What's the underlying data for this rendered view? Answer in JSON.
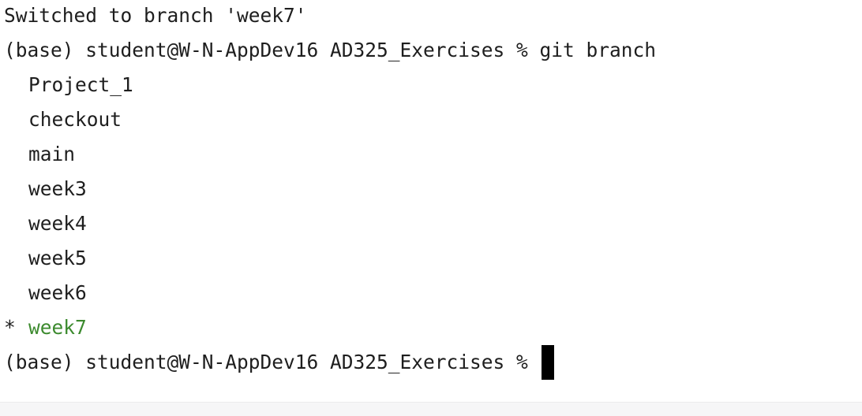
{
  "terminal": {
    "output_switch": "Switched to branch 'week7'",
    "prompt_1": "(base) student@W-N-AppDev16 AD325_Exercises % ",
    "command_1": "git branch",
    "branches": [
      "Project_1",
      "checkout",
      "main",
      "week3",
      "week4",
      "week5",
      "week6"
    ],
    "current_marker": "*",
    "current_branch": "week7",
    "prompt_2": "(base) student@W-N-AppDev16 AD325_Exercises % ",
    "current_branch_color": "#3c8a2e"
  }
}
